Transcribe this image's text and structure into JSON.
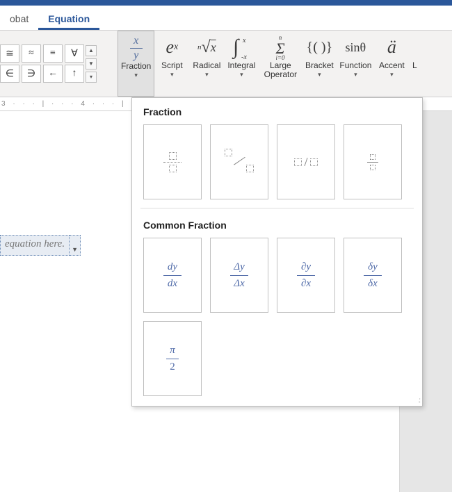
{
  "tabs": {
    "left": "obat",
    "equation": "Equation"
  },
  "symbols": {
    "row1": [
      "≅",
      "≈",
      "≡",
      "∀"
    ],
    "row2": [
      "∈",
      "∋",
      "←",
      "↑"
    ]
  },
  "structures": {
    "fraction": {
      "label": "Fraction"
    },
    "script": {
      "label": "Script"
    },
    "radical": {
      "label": "Radical"
    },
    "integral": {
      "label": "Integral"
    },
    "largeop": {
      "label": "Large\nOperator"
    },
    "bracket": {
      "label": "Bracket"
    },
    "function": {
      "label": "Function"
    },
    "accent": {
      "label": "Accent"
    },
    "limit_cut": {
      "label": "L"
    }
  },
  "ruler": "3 · · · | · · · 4 · · · | ·",
  "equation_placeholder": "equation here.",
  "dropdown": {
    "section1": "Fraction",
    "section2": "Common Fraction",
    "common": {
      "f1": {
        "num": "dy",
        "den": "dx"
      },
      "f2": {
        "num": "Δy",
        "den": "Δx"
      },
      "f3": {
        "num": "∂y",
        "den": "∂x"
      },
      "f4": {
        "num": "δy",
        "den": "δx"
      },
      "f5": {
        "num": "π",
        "den": "2"
      }
    }
  }
}
